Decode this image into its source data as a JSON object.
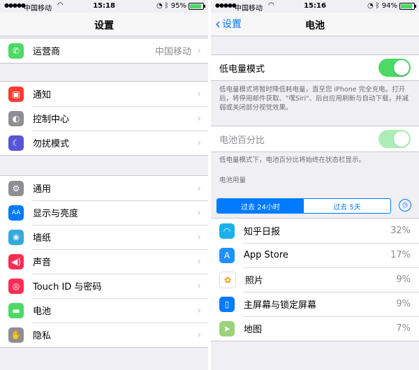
{
  "left": {
    "status": {
      "signal": "●●●●●",
      "carrier": "中国移动",
      "time": "15:18",
      "battery": "95%",
      "battery_level": 0.95
    },
    "nav": {
      "title": "设置"
    },
    "group1": [
      {
        "label": "运营商",
        "detail": "中国移动",
        "icon": "phone-icon",
        "color": "#4cd964",
        "glyph": "✆"
      }
    ],
    "group2": [
      {
        "label": "通知",
        "icon": "notifications-icon",
        "color": "#ff3b30",
        "glyph": "▣"
      },
      {
        "label": "控制中心",
        "icon": "control-center-icon",
        "color": "#8e8e93",
        "glyph": "◐"
      },
      {
        "label": "勿扰模式",
        "icon": "moon-icon",
        "color": "#5856d6",
        "glyph": "☾"
      }
    ],
    "group3": [
      {
        "label": "通用",
        "icon": "gear-icon",
        "color": "#8e8e93",
        "glyph": "⚙"
      },
      {
        "label": "显示与亮度",
        "icon": "display-icon",
        "color": "#007aff",
        "glyph": "AA"
      },
      {
        "label": "墙纸",
        "icon": "wallpaper-icon",
        "color": "#34aadc",
        "glyph": "❀"
      },
      {
        "label": "声音",
        "icon": "sound-icon",
        "color": "#ff2d55",
        "glyph": "◀)"
      },
      {
        "label": "Touch ID 与密码",
        "icon": "fingerprint-icon",
        "color": "#ff2d55",
        "glyph": "◎"
      },
      {
        "label": "电池",
        "icon": "battery-icon",
        "color": "#4cd964",
        "glyph": "▬"
      },
      {
        "label": "隐私",
        "icon": "hand-icon",
        "color": "#8e8e93",
        "glyph": "✋"
      }
    ]
  },
  "right": {
    "status": {
      "signal": "●●●●●",
      "carrier": "中国移动",
      "time": "15:16",
      "battery": "94%",
      "battery_level": 0.94
    },
    "nav": {
      "back": "设置",
      "title": "电池"
    },
    "low_power": {
      "label": "低电量模式",
      "on": true,
      "footer": "低电量模式将暂时降低耗电量，直至您 iPhone 完全充电。打开后，将停用邮件获取、\"嘿Siri\"、后台应用刷新与自动下载，并减弱或关闭部分视觉效果。"
    },
    "percentage": {
      "label": "电池百分比",
      "on": true,
      "footer": "低电量模式下，电池百分比将始终在状态栏显示。"
    },
    "usage_header": "电池用量",
    "tabs": {
      "active": "过去 24小时",
      "inactive": "过去 5天"
    },
    "apps": [
      {
        "name": "知乎日报",
        "pct": "32%",
        "icon": "zhihu-icon",
        "color": "#1ab0ec",
        "glyph": "◠"
      },
      {
        "name": "App Store",
        "pct": "17%",
        "icon": "app-store-icon",
        "color": "#1e90ff",
        "glyph": "A"
      },
      {
        "name": "照片",
        "pct": "9%",
        "icon": "photos-icon",
        "color": "#ffffff",
        "glyph": "✿"
      },
      {
        "name": "主屏幕与锁定屏幕",
        "pct": "9%",
        "icon": "home-screen-icon",
        "color": "#007aff",
        "glyph": "▯"
      },
      {
        "name": "地图",
        "pct": "7%",
        "icon": "maps-icon",
        "color": "#9bd27a",
        "glyph": "➤"
      }
    ]
  }
}
